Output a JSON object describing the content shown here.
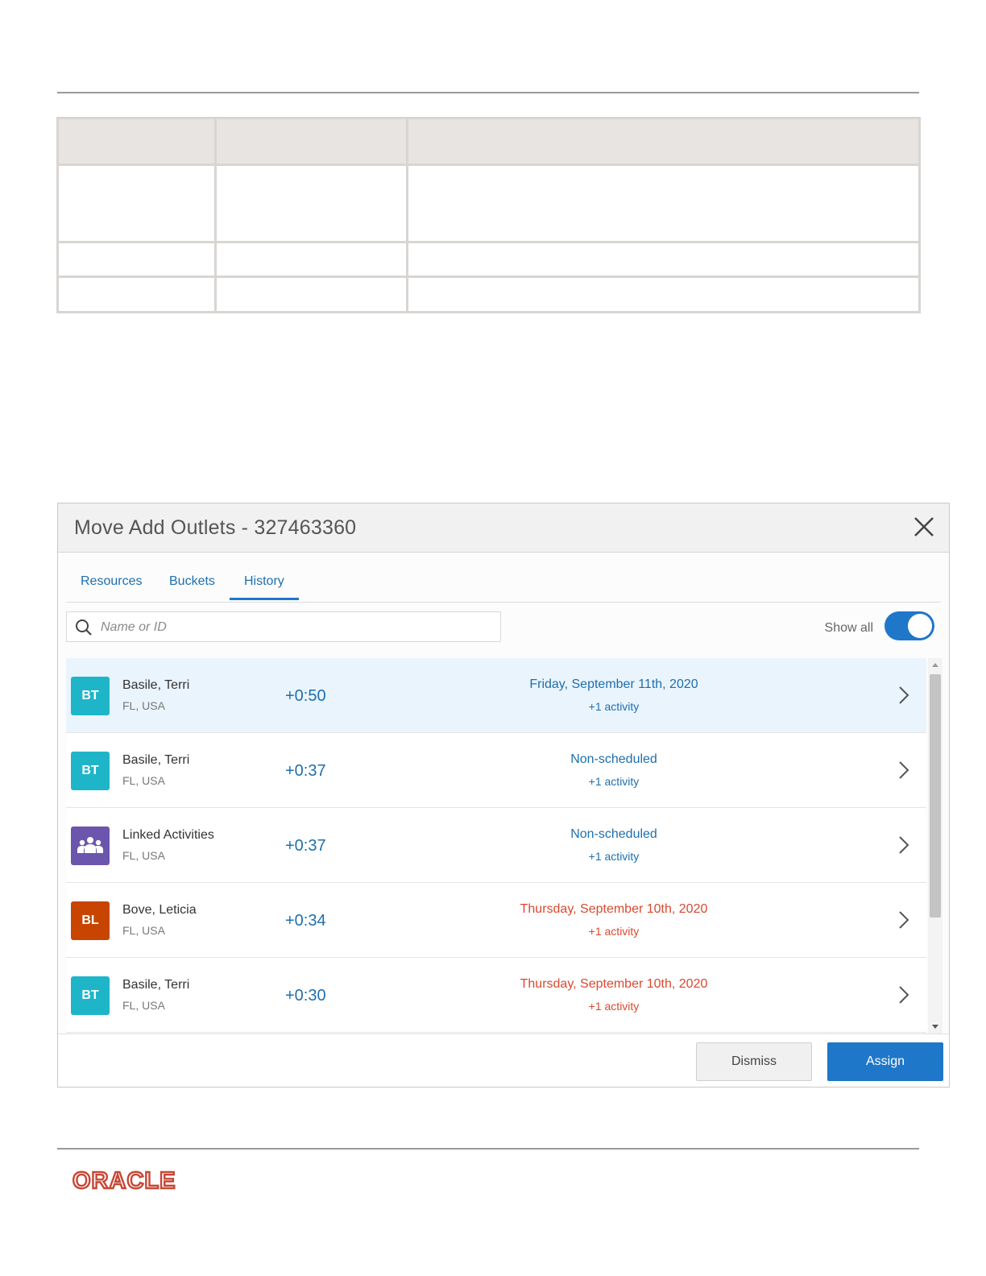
{
  "dialog": {
    "title": "Move Add Outlets - 327463360",
    "tabs": [
      {
        "label": "Resources",
        "active": false
      },
      {
        "label": "Buckets",
        "active": false
      },
      {
        "label": "History",
        "active": true
      }
    ],
    "search": {
      "placeholder": "Name or ID",
      "value": ""
    },
    "show_all": {
      "label": "Show all",
      "enabled": true
    },
    "rows": [
      {
        "initials": "BT",
        "avatar_color": "#1fb5c9",
        "name": "Basile, Terri",
        "location": "FL, USA",
        "delta": "+0:50",
        "when": "Friday, September 11th, 2020",
        "when_color": "blue",
        "activity": "+1 activity",
        "selected": true
      },
      {
        "initials": "BT",
        "avatar_color": "#1fb5c9",
        "name": "Basile, Terri",
        "location": "FL, USA",
        "delta": "+0:37",
        "when": "Non-scheduled",
        "when_color": "blue",
        "activity": "+1 activity",
        "selected": false
      },
      {
        "initials": "",
        "icon": "group-icon",
        "avatar_color": "#6c55ad",
        "name": "Linked Activities",
        "location": "FL, USA",
        "delta": "+0:37",
        "when": "Non-scheduled",
        "when_color": "blue",
        "activity": "+1 activity",
        "selected": false
      },
      {
        "initials": "BL",
        "avatar_color": "#c74500",
        "name": "Bove, Leticia",
        "location": "FL, USA",
        "delta": "+0:34",
        "when": "Thursday, September 10th, 2020",
        "when_color": "red",
        "activity": "+1 activity",
        "selected": false
      },
      {
        "initials": "BT",
        "avatar_color": "#1fb5c9",
        "name": "Basile, Terri",
        "location": "FL, USA",
        "delta": "+0:30",
        "when": "Thursday, September 10th, 2020",
        "when_color": "red",
        "activity": "+1 activity",
        "selected": false
      }
    ],
    "buttons": {
      "dismiss": "Dismiss",
      "assign": "Assign"
    }
  },
  "footer": {
    "logo": "ORACLE",
    "logo_color": "#c74634"
  },
  "colors": {
    "accent": "#1f77c9",
    "link": "#1d6fae",
    "past_date": "#d9492f"
  }
}
